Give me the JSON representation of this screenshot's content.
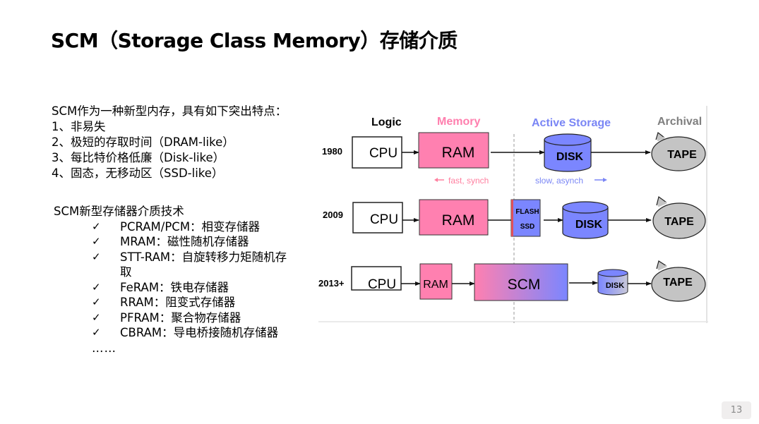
{
  "title": "SCM（Storage Class Memory）存储介质",
  "features": {
    "intro": "SCM作为一种新型内存，具有如下突出特点：",
    "items": [
      "1、非易失",
      "2、极短的存取时间（DRAM-like）",
      "3、每比特价格低廉（Disk-like）",
      "4、固态，无移动区（SSD-like）"
    ]
  },
  "tech": {
    "heading": "SCM新型存储器介质技术",
    "check_icon": "✓",
    "items": [
      "PCRAM/PCM：相变存储器",
      "MRAM：磁性随机存储器",
      "STT-RAM：自旋转移力矩随机存取",
      "FeRAM：铁电存储器",
      "RRAM：阻变式存储器",
      "PFRAM：聚合物存储器",
      "CBRAM：导电桥接随机存储器"
    ],
    "ellipsis": "……"
  },
  "diagram": {
    "headers": {
      "logic": "Logic",
      "memory": "Memory",
      "active_storage": "Active Storage",
      "archival": "Archival"
    },
    "notes": {
      "fast": "fast, synch",
      "slow": "slow, asynch"
    },
    "rows": [
      {
        "year": "1980",
        "cpu": "CPU",
        "ram": "RAM",
        "disk": "DISK",
        "tape": "TAPE"
      },
      {
        "year": "2009",
        "cpu": "CPU",
        "ram": "RAM",
        "flash_line1": "FLASH",
        "flash_line2": "SSD",
        "disk": "DISK",
        "tape": "TAPE"
      },
      {
        "year": "2013+",
        "cpu": "CPU",
        "ram": "RAM",
        "scm": "SCM",
        "disk": "DISK",
        "tape": "TAPE"
      }
    ],
    "colors": {
      "memory": "#ff80b0",
      "storage": "#7b86ff",
      "archival": "#c4c4c4",
      "logic_header": "#111111",
      "memory_header": "#ff7fae",
      "storage_header": "#7a86f5",
      "archival_header": "#7f7f7f"
    }
  },
  "page_number": "13"
}
